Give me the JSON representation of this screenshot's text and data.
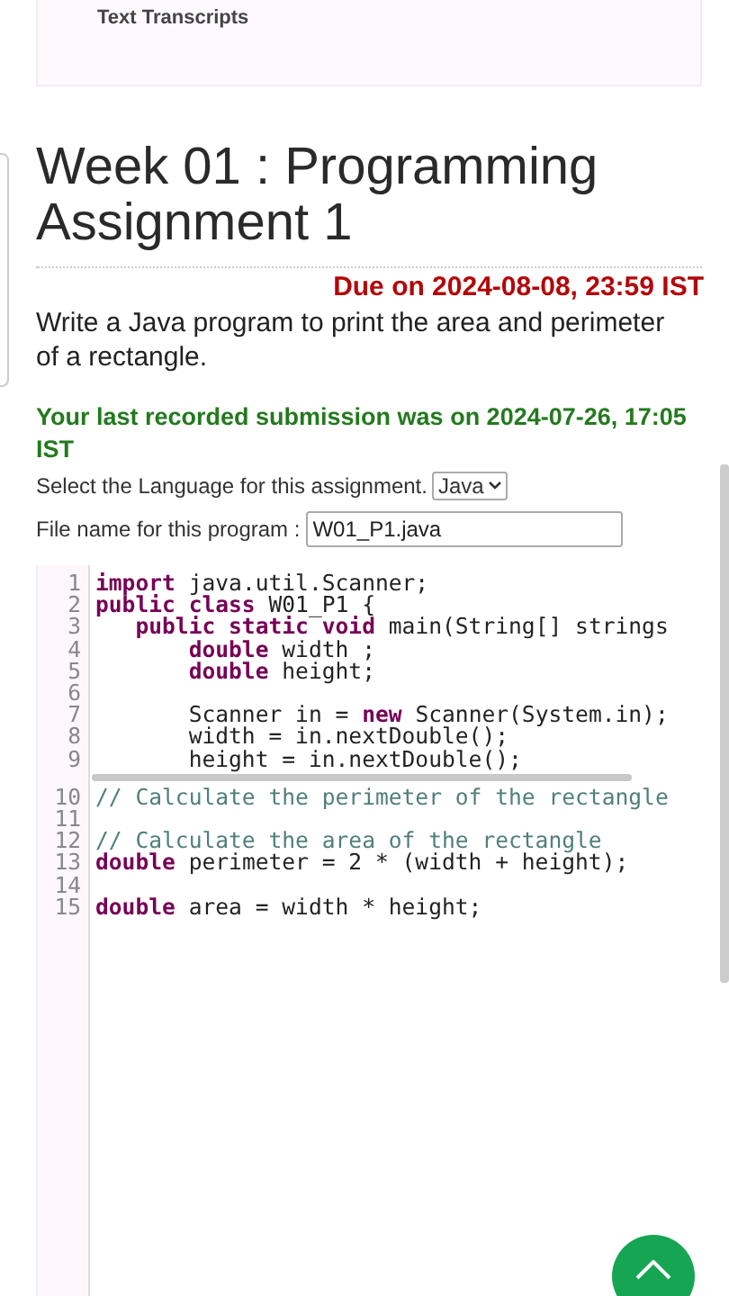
{
  "top_card": {
    "label": "Text Transcripts"
  },
  "assignment": {
    "title": "Week 01 : Programming Assignment 1",
    "due": "Due on 2024-08-08, 23:59 IST",
    "description": "Write a Java program to print the area and perimeter of a rectangle.",
    "last_submission": "Your last recorded submission was on 2024-07-26, 17:05 IST"
  },
  "language": {
    "label": "Select the Language for this assignment.",
    "value": "Java"
  },
  "file_name": {
    "label": "File name for this program :",
    "value": "W01_P1.java"
  },
  "editor": {
    "scroll_region": [
      {
        "number": "1",
        "segments": [
          {
            "kind": "keyword",
            "text": "import"
          },
          {
            "kind": "plain",
            "text": " java.util.Scanner;"
          }
        ]
      },
      {
        "number": "2",
        "segments": [
          {
            "kind": "keyword",
            "text": "public class"
          },
          {
            "kind": "plain",
            "text": " W01_P1 {"
          }
        ]
      },
      {
        "number": "3",
        "segments": [
          {
            "kind": "keyword",
            "text": "   public static void"
          },
          {
            "kind": "plain",
            "text": " main(String[] strings"
          }
        ]
      },
      {
        "number": "4",
        "segments": [
          {
            "kind": "keyword",
            "text": "       double"
          },
          {
            "kind": "plain",
            "text": " width ;"
          }
        ]
      },
      {
        "number": "5",
        "segments": [
          {
            "kind": "keyword",
            "text": "       double"
          },
          {
            "kind": "plain",
            "text": " height;"
          }
        ]
      },
      {
        "number": "6"
      },
      {
        "number": "7",
        "segments": [
          {
            "kind": "plain",
            "text": "       Scanner in = "
          },
          {
            "kind": "keyword",
            "text": "new"
          },
          {
            "kind": "plain",
            "text": " Scanner(System.in);"
          }
        ]
      },
      {
        "number": "8",
        "segments": [
          {
            "kind": "plain",
            "text": "       width = in.nextDouble();"
          }
        ]
      },
      {
        "number": "9",
        "segments": [
          {
            "kind": "plain",
            "text": "       height = in.nextDouble();"
          }
        ]
      }
    ],
    "lines": [
      {
        "number": "10",
        "segments": [
          {
            "kind": "comment",
            "text": "// Calculate the perimeter of the rectangle"
          }
        ]
      },
      {
        "number": "11"
      },
      {
        "number": "12",
        "segments": [
          {
            "kind": "comment",
            "text": "// Calculate the area of the rectangle"
          }
        ]
      },
      {
        "number": "13",
        "segments": [
          {
            "kind": "keyword",
            "text": "double"
          },
          {
            "kind": "plain",
            "text": " perimeter = 2 * (width + height);"
          }
        ]
      },
      {
        "number": "14"
      },
      {
        "number": "15",
        "segments": [
          {
            "kind": "keyword",
            "text": "double"
          },
          {
            "kind": "plain",
            "text": " area = width * height;"
          }
        ]
      }
    ]
  }
}
